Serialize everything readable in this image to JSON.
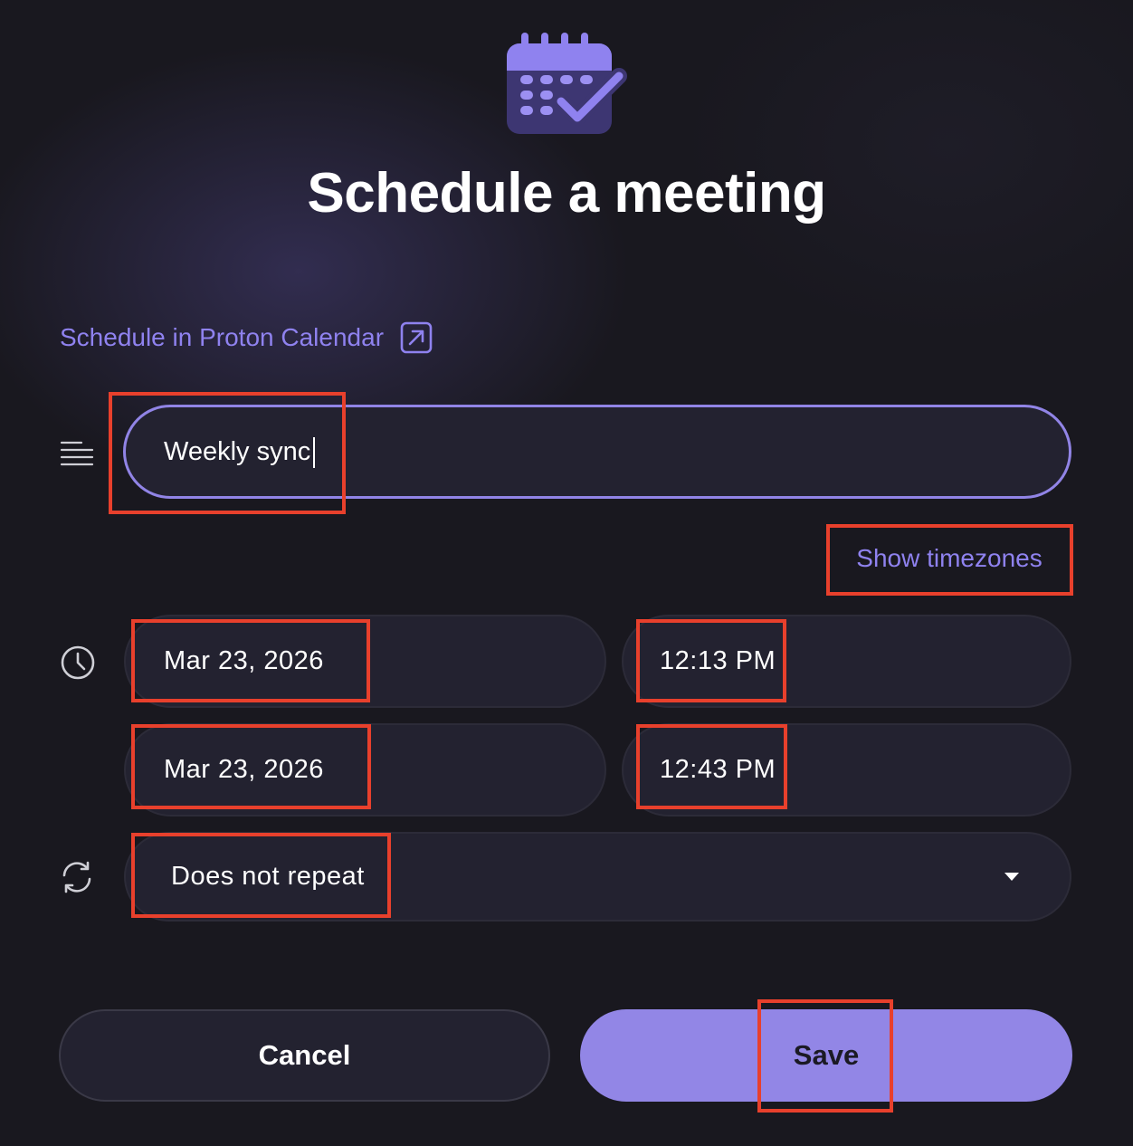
{
  "header": {
    "title": "Schedule a meeting",
    "icon": "calendar-check-icon"
  },
  "proton_link": {
    "label": "Schedule in Proton Calendar",
    "icon": "external-link-icon"
  },
  "meeting_title": {
    "icon": "text-align-icon",
    "value": "Weekly sync"
  },
  "show_timezones_label": "Show timezones",
  "time_section": {
    "icon": "clock-icon",
    "start_date": "Mar 23, 2026",
    "start_time": "12:13 PM",
    "end_date": "Mar 23, 2026",
    "end_time": "12:43 PM"
  },
  "recurrence": {
    "icon": "repeat-icon",
    "selected": "Does not repeat",
    "dropdown_icon": "chevron-down-icon"
  },
  "actions": {
    "cancel_label": "Cancel",
    "save_label": "Save"
  },
  "colors": {
    "accent": "#9286e6",
    "link": "#8f82ef",
    "background": "#19181f",
    "field_background": "#232230",
    "annotation": "#e8402c"
  }
}
